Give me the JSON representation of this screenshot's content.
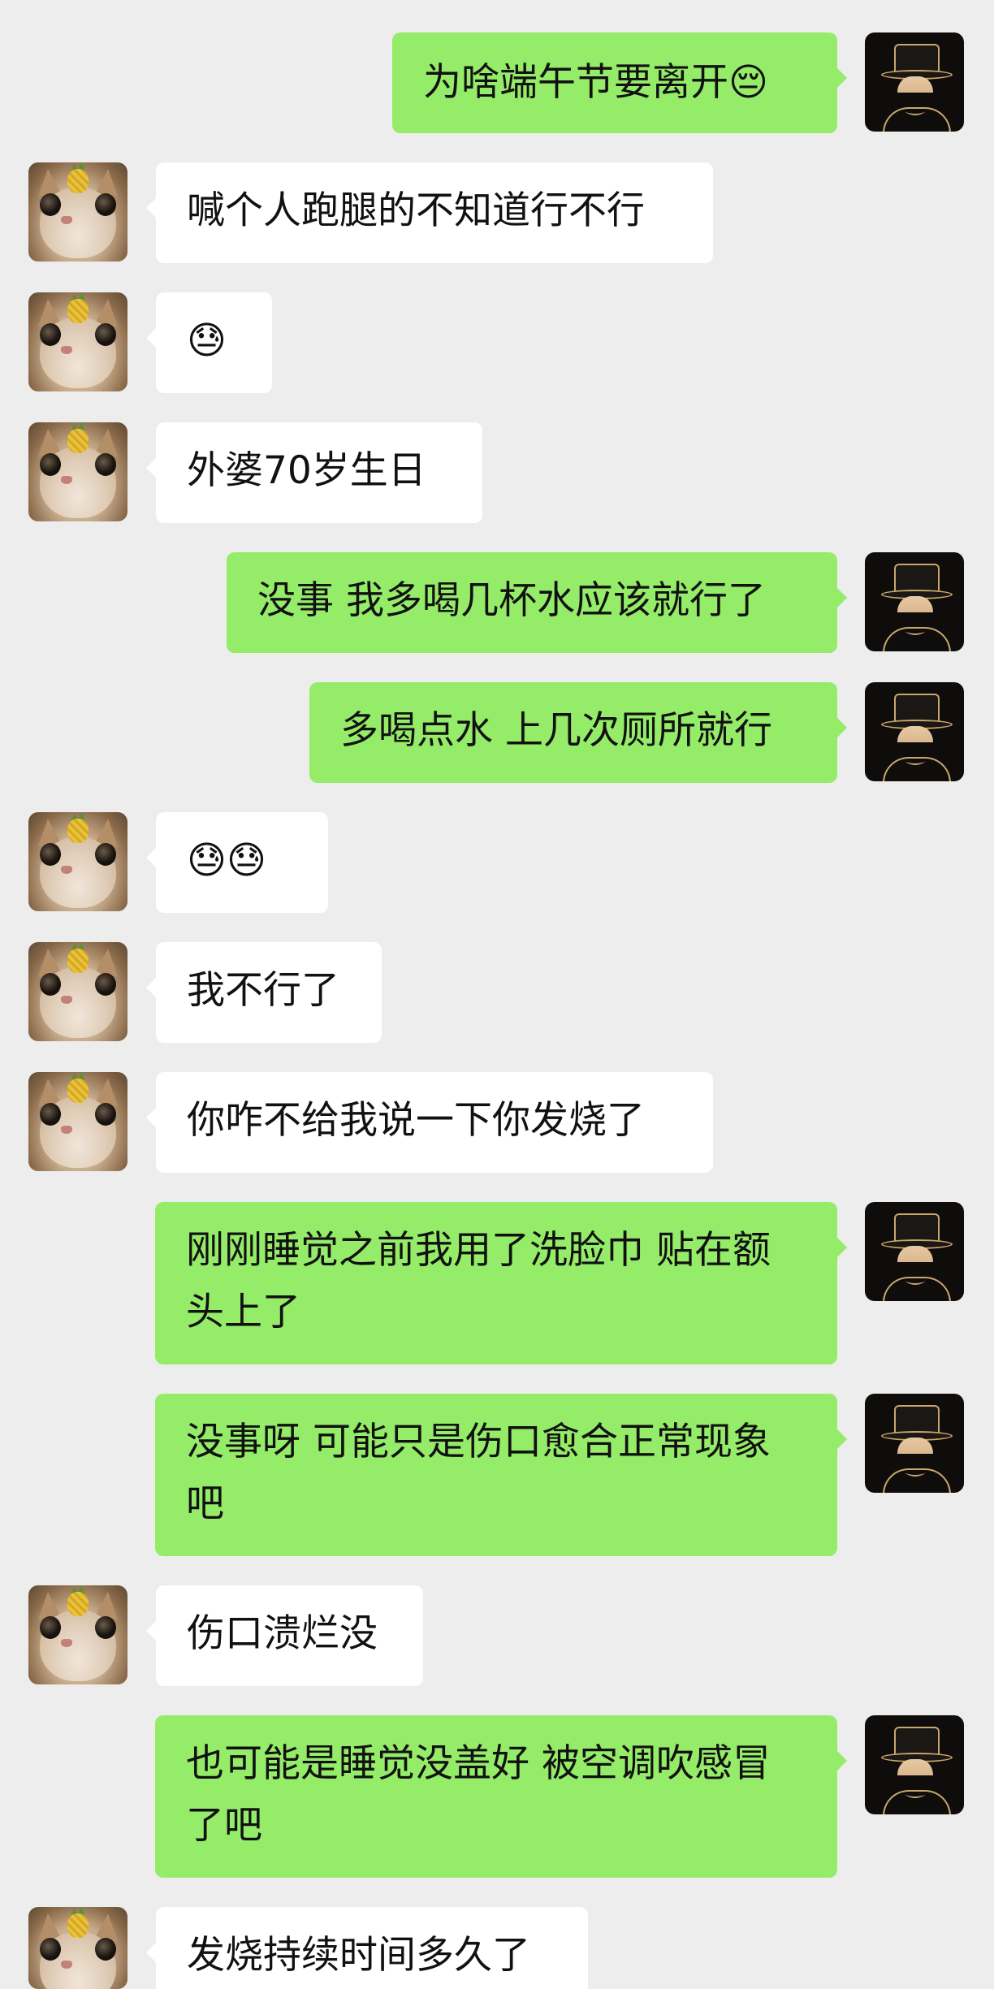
{
  "messages": [
    {
      "side": "right",
      "text": "为啥端午节要离开😔"
    },
    {
      "side": "left",
      "text": "喊个人跑腿的不知道行不行"
    },
    {
      "side": "left",
      "text": "😓"
    },
    {
      "side": "left",
      "text": "外婆70岁生日"
    },
    {
      "side": "right",
      "text": "没事 我多喝几杯水应该就行了"
    },
    {
      "side": "right",
      "text": "多喝点水 上几次厕所就行"
    },
    {
      "side": "left",
      "text": "😓😓"
    },
    {
      "side": "left",
      "text": "我不行了"
    },
    {
      "side": "left",
      "text": "你咋不给我说一下你发烧了"
    },
    {
      "side": "right",
      "text": "刚刚睡觉之前我用了洗脸巾 贴在额头上了"
    },
    {
      "side": "right",
      "text": "没事呀 可能只是伤口愈合正常现象吧"
    },
    {
      "side": "left",
      "text": "伤口溃烂没"
    },
    {
      "side": "right",
      "text": "也可能是睡觉没盖好 被空调吹感冒了吧"
    },
    {
      "side": "left",
      "text": "发烧持续时间多久了"
    }
  ],
  "colors": {
    "background": "#ededed",
    "sent_bubble": "#95ec69",
    "received_bubble": "#ffffff"
  },
  "icons": {
    "contact_avatar": "cat-with-pineapple-avatar-icon",
    "self_avatar": "hat-man-avatar-icon"
  }
}
